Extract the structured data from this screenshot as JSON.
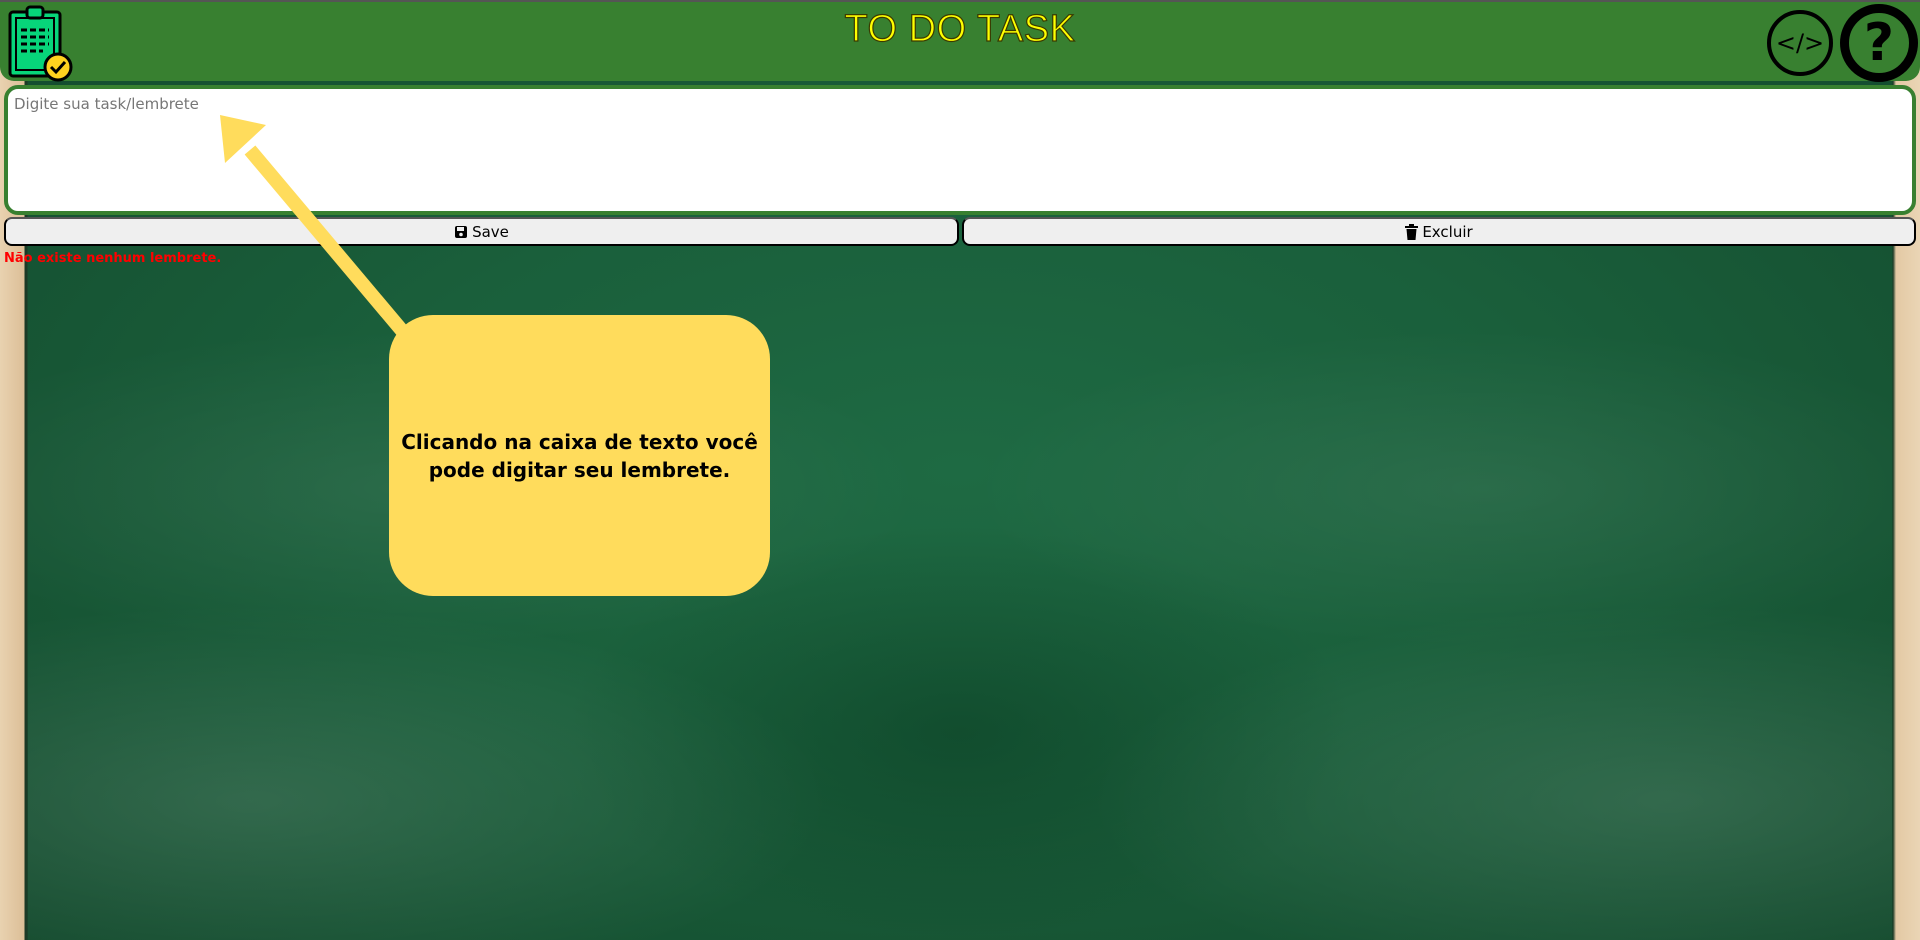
{
  "header": {
    "title": "TO DO TASK",
    "code_icon_label": "</>",
    "help_icon_label": "?"
  },
  "task_input": {
    "placeholder": "Digite sua task/lembrete",
    "value": ""
  },
  "buttons": {
    "save": "Save",
    "delete": "Excluir"
  },
  "status_message": "Não existe nenhum lembrete.",
  "tooltip": {
    "text": "Clicando na caixa de texto você pode digitar seu lembrete."
  },
  "colors": {
    "header": "#388030",
    "title": "#ffff00",
    "tooltip": "#ffdc5c",
    "message": "#ff0000"
  }
}
